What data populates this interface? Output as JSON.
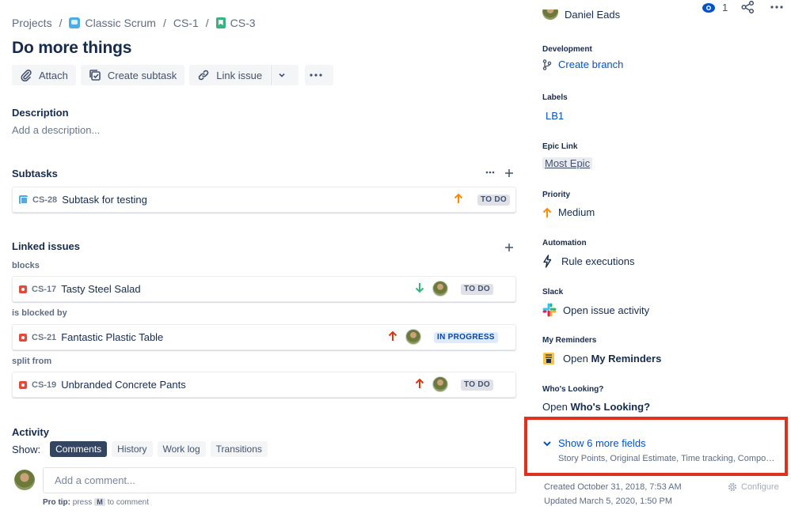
{
  "breadcrumb": {
    "projects": "Projects",
    "project": "Classic Scrum",
    "parent": "CS-1",
    "issue": "CS-3",
    "separator": "/"
  },
  "issue": {
    "title": "Do more things"
  },
  "toolbar": {
    "attach": "Attach",
    "create_subtask": "Create subtask",
    "link_issue": "Link issue"
  },
  "description": {
    "heading": "Description",
    "placeholder": "Add a description..."
  },
  "subtasks": {
    "heading": "Subtasks",
    "items": [
      {
        "key": "CS-28",
        "summary": "Subtask for testing",
        "status": "TO DO",
        "priority": "high"
      }
    ]
  },
  "linked_issues": {
    "heading": "Linked issues",
    "groups": [
      {
        "relation": "blocks",
        "items": [
          {
            "key": "CS-17",
            "summary": "Tasty Steel Salad",
            "status": "TO DO",
            "priority": "low"
          }
        ]
      },
      {
        "relation": "is blocked by",
        "items": [
          {
            "key": "CS-21",
            "summary": "Fantastic Plastic Table",
            "status": "IN PROGRESS",
            "priority": "highest"
          }
        ]
      },
      {
        "relation": "split from",
        "items": [
          {
            "key": "CS-19",
            "summary": "Unbranded Concrete Pants",
            "status": "TO DO",
            "priority": "highest"
          }
        ]
      }
    ]
  },
  "activity": {
    "heading": "Activity",
    "show_label": "Show:",
    "tabs": [
      "Comments",
      "History",
      "Work log",
      "Transitions"
    ],
    "active_tab": "Comments",
    "comment_placeholder": "Add a comment...",
    "protip_label": "Pro tip:",
    "protip_press": "press",
    "protip_key": "M",
    "protip_suffix": "to comment"
  },
  "header_actions": {
    "watch_count": "1"
  },
  "sidebar": {
    "assignee_partial": "Daniel Eads",
    "development": {
      "label": "Development",
      "value": "Create branch"
    },
    "labels": {
      "label": "Labels",
      "value": "LB1"
    },
    "epic_link": {
      "label": "Epic Link",
      "value": "Most Epic"
    },
    "priority": {
      "label": "Priority",
      "value": "Medium"
    },
    "automation": {
      "label": "Automation",
      "value": "Rule executions"
    },
    "slack": {
      "label": "Slack",
      "value": "Open issue activity"
    },
    "my_reminders": {
      "label": "My Reminders",
      "value_prefix": "Open",
      "value_bold": "My Reminders"
    },
    "whos_looking": {
      "label": "Who's Looking?",
      "value_prefix": "Open",
      "value_bold": "Who's Looking?"
    },
    "more_fields": {
      "title": "Show 6 more fields",
      "subtitle": "Story Points, Original Estimate, Time tracking, Component..."
    },
    "created": "Created October 31, 2018, 7:53 AM",
    "updated": "Updated March 5, 2020, 1:50 PM",
    "configure": "Configure"
  },
  "colors": {
    "link": "#0052cc",
    "highlight_border": "#e0301e",
    "priority_high": "#ff8b00",
    "priority_highest": "#de350b",
    "priority_low": "#36b37e"
  },
  "icons": [
    "attach-icon",
    "checkbox-icon",
    "link-icon",
    "chevron-down-icon",
    "more-icon",
    "eye-icon",
    "share-icon",
    "branch-icon",
    "lightning-icon",
    "slack-icon",
    "reminder-icon",
    "gear-icon",
    "plus-icon"
  ]
}
